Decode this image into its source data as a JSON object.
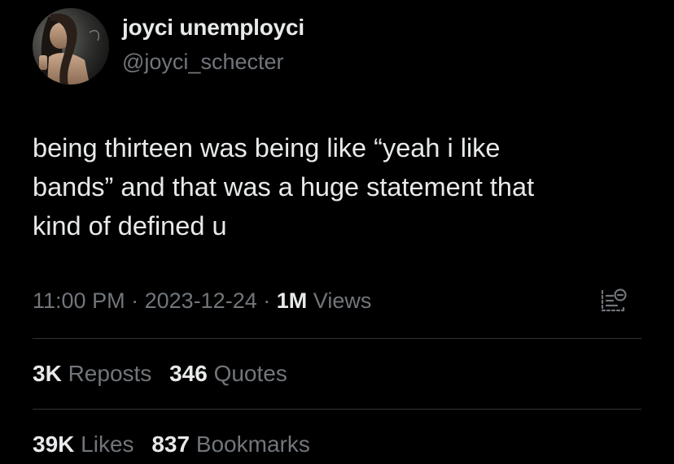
{
  "author": {
    "display_name": "joyci unemployci",
    "handle": "@joyci_schecter"
  },
  "tweet": {
    "lines": [
      "being thirteen was being like “yeah i like",
      "bands” and that was a huge statement that",
      "kind of defined u"
    ]
  },
  "meta": {
    "time": "11:00 PM",
    "separator": "·",
    "date": "2023-12-24",
    "views_count": "1M",
    "views_label": "Views"
  },
  "stats": {
    "reposts_count": "3K",
    "reposts_label": "Reposts",
    "quotes_count": "346",
    "quotes_label": "Quotes",
    "likes_count": "39K",
    "likes_label": "Likes",
    "bookmarks_count": "837",
    "bookmarks_label": "Bookmarks"
  },
  "icons": {
    "analytics": "analytics-icon"
  },
  "colors": {
    "background": "#000000",
    "primary_text": "#e7e9ea",
    "secondary_text": "#71767b",
    "divider": "#2f3336"
  }
}
